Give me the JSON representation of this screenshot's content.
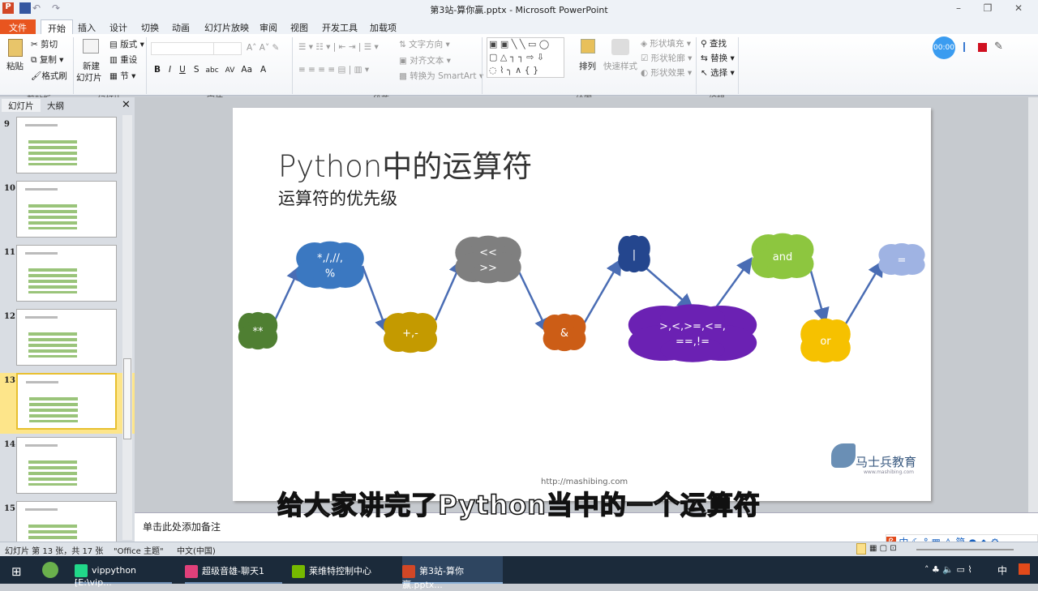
{
  "window": {
    "title": "第3站-算你赢.pptx - Microsoft PowerPoint",
    "app_icon_letter": "P"
  },
  "tabs": [
    "文件",
    "开始",
    "插入",
    "设计",
    "切换",
    "动画",
    "幻灯片放映",
    "审阅",
    "视图",
    "开发工具",
    "加载项"
  ],
  "ribbon": {
    "clipboard": {
      "paste": "粘贴",
      "cut": "剪切",
      "copy": "复制",
      "format_painter": "格式刷",
      "label": "剪贴板"
    },
    "slides": {
      "new_slide_1": "新建",
      "new_slide_2": "幻灯片",
      "layout": "版式",
      "reset": "重设",
      "section": "节",
      "label": "幻灯片"
    },
    "font": {
      "label": "字体",
      "buttons": [
        "B",
        "I",
        "U",
        "S",
        "abc",
        "AV",
        "Aa",
        "A"
      ]
    },
    "paragraph": {
      "text_direction": "文字方向",
      "align_text": "对齐文本",
      "smartart": "转换为 SmartArt",
      "label": "段落"
    },
    "drawing": {
      "arrange": "排列",
      "quick_styles": "快速样式",
      "shape_fill": "形状填充",
      "shape_outline": "形状轮廓",
      "shape_effects": "形状效果",
      "label": "绘图"
    },
    "editing": {
      "find": "查找",
      "replace": "替换",
      "select": "选择",
      "label": "编辑"
    },
    "recorder": {
      "timer": "00:00"
    }
  },
  "panel": {
    "tabs": [
      "幻灯片",
      "大纲"
    ],
    "slides": [
      "9",
      "10",
      "11",
      "12",
      "13",
      "14",
      "15"
    ],
    "selected": "13"
  },
  "slide": {
    "title": "Python中的运算符",
    "subtitle": "运算符的优先级",
    "clouds": [
      {
        "lines": [
          "**"
        ],
        "color": "#4f7f32"
      },
      {
        "lines": [
          "*,/,//,",
          "%"
        ],
        "color": "#3b78c1"
      },
      {
        "lines": [
          "+,-"
        ],
        "color": "#c49a00"
      },
      {
        "lines": [
          "<<",
          ">>"
        ],
        "color": "#7f7f7f"
      },
      {
        "lines": [
          "&"
        ],
        "color": "#cc5d16"
      },
      {
        "lines": [
          "|"
        ],
        "color": "#24468e"
      },
      {
        "lines": [
          ">,<,>=,<=,",
          "==,!="
        ],
        "color": "#6b21b3"
      },
      {
        "lines": [
          "and"
        ],
        "color": "#8dc63f"
      },
      {
        "lines": [
          "or"
        ],
        "color": "#f6c100"
      },
      {
        "lines": [
          "="
        ],
        "color": "#9fb3e3"
      }
    ],
    "arrow_color": "#4a6db4",
    "url": "http://mashibing.com",
    "logo_text": "马士兵教育",
    "logo_sub": "www.mashibing.com"
  },
  "notes": {
    "placeholder": "单击此处添加备注"
  },
  "status": {
    "slide_info": "幻灯片 第 13 张，共 17 张",
    "theme": "\"Office 主题\"",
    "language": "中文(中国)"
  },
  "taskbar": {
    "items": [
      "vippython [E:\\vip...",
      "超级音雄-聊天1",
      "莱维特控制中心",
      "第3站-算你赢.pptx..."
    ],
    "ime": "中"
  },
  "overlay": {
    "caption": "给大家讲完了Python当中的一个运算符"
  }
}
